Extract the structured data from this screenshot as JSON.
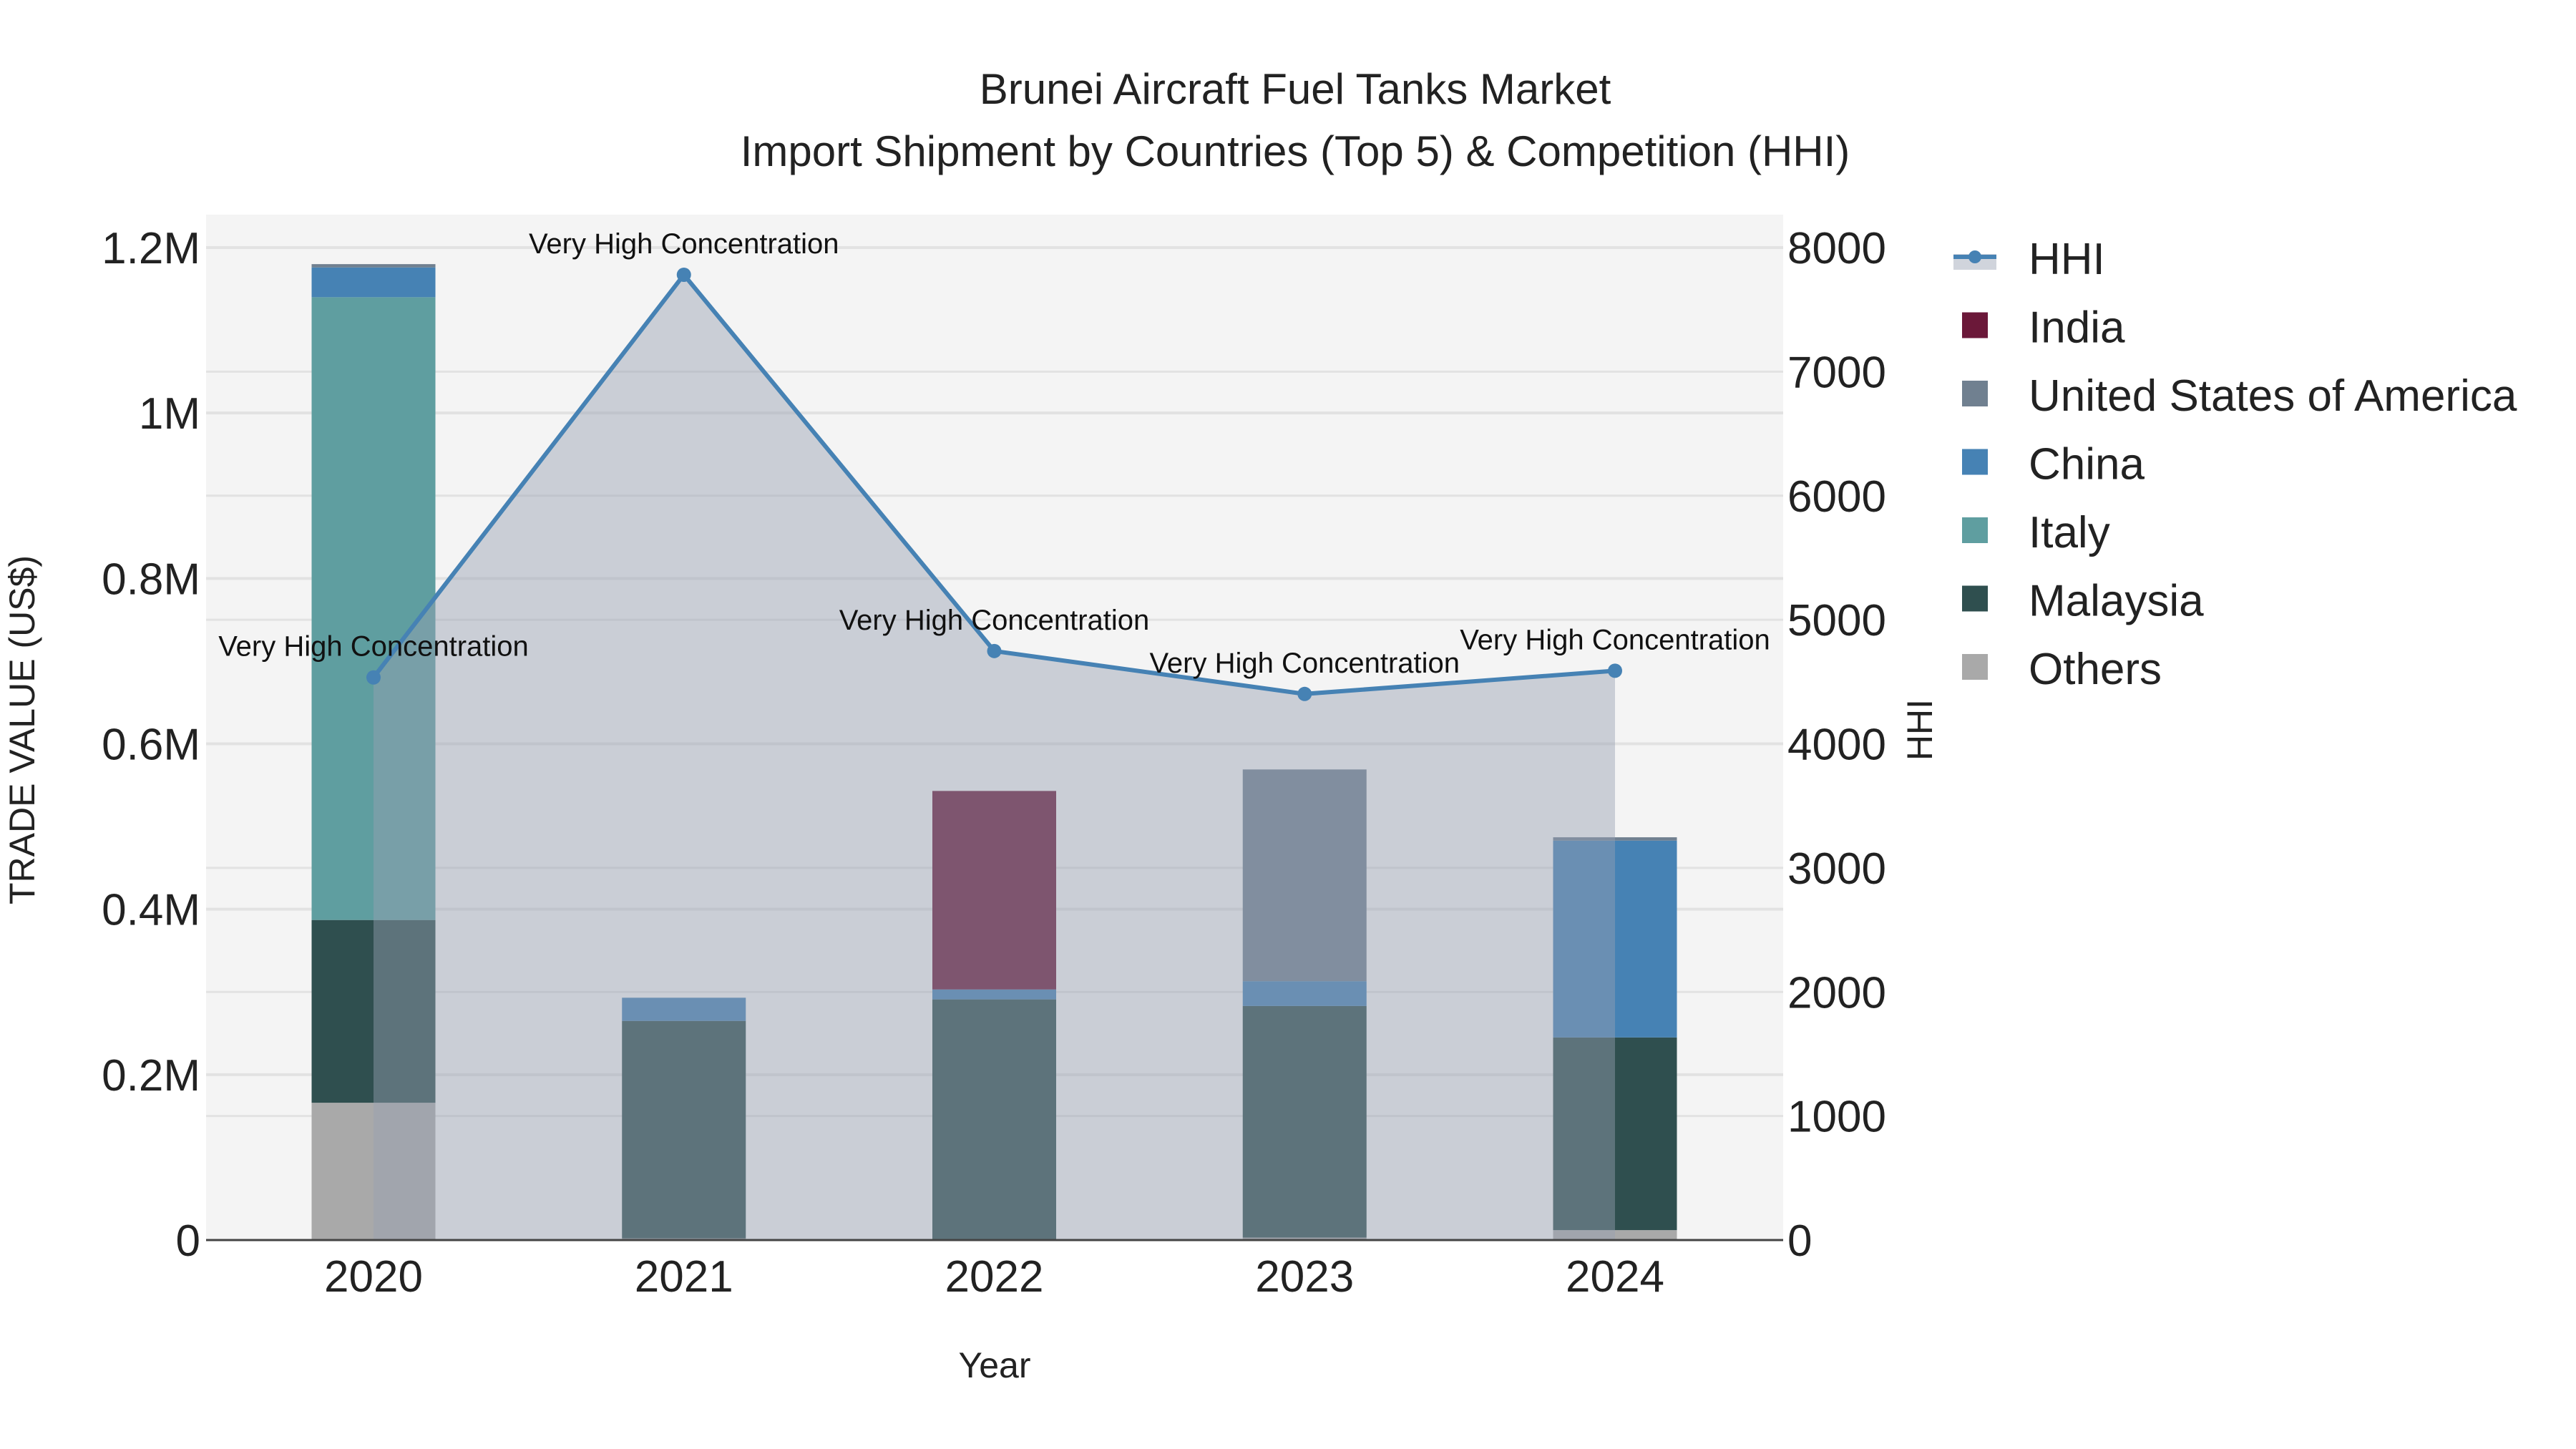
{
  "chart_data": {
    "type": "bar",
    "title": "Brunei Aircraft Fuel Tanks Market",
    "subtitle": "Import Shipment by Countries (Top 5) & Competition (HHI)",
    "xlabel": "Year",
    "ylabel": "TRADE VALUE (US$)",
    "y2label": "HHI",
    "categories": [
      "2020",
      "2021",
      "2022",
      "2023",
      "2024"
    ],
    "ylim": [
      0,
      1200000
    ],
    "y_ticks": [
      0,
      200000,
      400000,
      600000,
      800000,
      1000000,
      1200000
    ],
    "y_tick_labels": [
      "0",
      "0.2M",
      "0.4M",
      "0.6M",
      "0.8M",
      "1M",
      "1.2M"
    ],
    "y2lim": [
      0,
      8000
    ],
    "y2_ticks": [
      0,
      1000,
      2000,
      3000,
      4000,
      5000,
      6000,
      7000,
      8000
    ],
    "y2_tick_labels": [
      "0",
      "1000",
      "2000",
      "3000",
      "4000",
      "5000",
      "6000",
      "7000",
      "8000"
    ],
    "stacking": "stacked",
    "legend_position": "right",
    "series": [
      {
        "name": "Others",
        "color": "#a9a9a9",
        "values": [
          166000,
          2000,
          0,
          3000,
          12000
        ]
      },
      {
        "name": "Malaysia",
        "color": "#2f4f4f",
        "values": [
          221000,
          263000,
          291000,
          280000,
          233000
        ]
      },
      {
        "name": "Italy",
        "color": "#5f9ea0",
        "values": [
          753000,
          0,
          0,
          0,
          0
        ]
      },
      {
        "name": "China",
        "color": "#4682b4",
        "values": [
          36000,
          28000,
          12000,
          30000,
          238000
        ]
      },
      {
        "name": "United States of America",
        "color": "#708090",
        "values": [
          4000,
          0,
          0,
          256000,
          4000
        ]
      },
      {
        "name": "India",
        "color": "#6b1839",
        "values": [
          0,
          0,
          240000,
          0,
          0
        ]
      }
    ],
    "hhi": {
      "name": "HHI",
      "color": "#4682b4",
      "values": [
        4535,
        7781,
        4748,
        4402,
        4589
      ],
      "annotations": [
        "Very High Concentration",
        "Very High Concentration",
        "Very High Concentration",
        "Very High Concentration",
        "Very High Concentration"
      ]
    },
    "legend_order": [
      "HHI",
      "India",
      "United States of America",
      "China",
      "Italy",
      "Malaysia",
      "Others"
    ]
  }
}
